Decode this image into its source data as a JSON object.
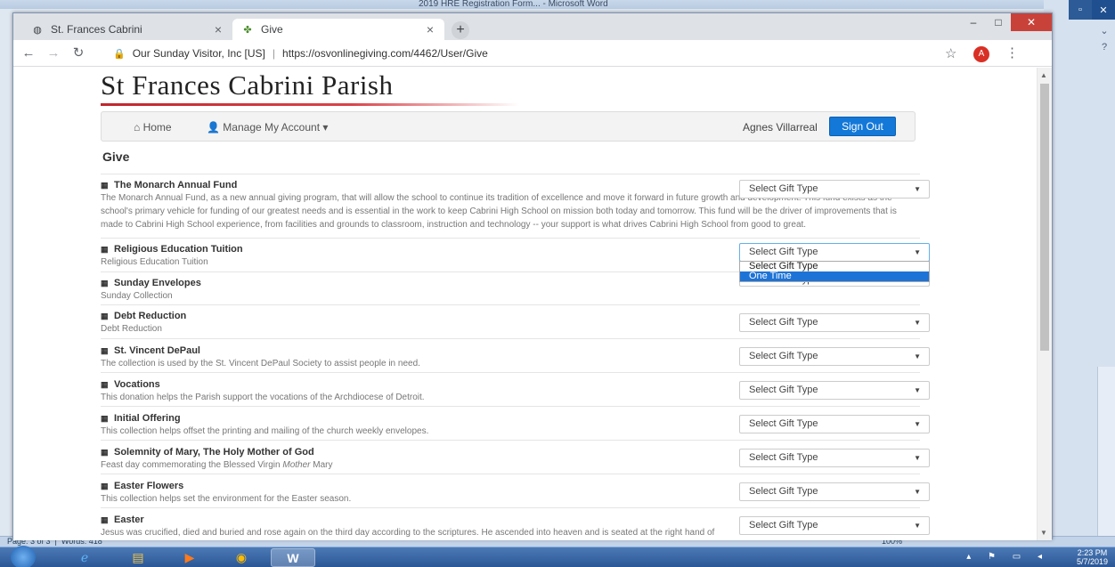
{
  "word": {
    "title": "2019 HRE Registration Form... - Microsoft Word",
    "status_page": "Page: 3 of 3",
    "status_words": "Words: 418",
    "zoom": "100%"
  },
  "browser": {
    "tabs": [
      {
        "label": "St. Frances Cabrini"
      },
      {
        "label": "Give"
      }
    ],
    "org": "Our Sunday Visitor, Inc [US]",
    "url": "https://osvonlinegiving.com/4462/User/Give",
    "profile_initial": "A"
  },
  "site": {
    "title": "St Frances Cabrini Parish",
    "nav_home": "Home",
    "nav_manage": "Manage My Account",
    "user_name": "Agnes Villarreal",
    "sign_out": "Sign Out",
    "page_heading": "Give"
  },
  "select_placeholder": "Select Gift Type",
  "dropdown_options": [
    "Select Gift Type",
    "One Time"
  ],
  "funds": [
    {
      "name": "The Monarch Annual Fund",
      "desc": "The Monarch Annual Fund, as a new annual giving program, that will allow the school to continue its tradition of excellence and move it forward in future growth and development.  This fund exists as the school's primary vehicle for funding of our greatest needs and is essential in the work to keep Cabrini High School on mission both today and tomorrow.  This fund will be the driver of improvements that is made to Cabrini High School experience, from facilities and grounds to classroom, instruction and technology -- your support is what drives Cabrini High School from good to great."
    },
    {
      "name": "Religious Education Tuition",
      "desc": "Religious Education Tuition"
    },
    {
      "name": "Sunday Envelopes",
      "desc": "Sunday Collection"
    },
    {
      "name": "Debt Reduction",
      "desc": "Debt Reduction"
    },
    {
      "name": "St. Vincent DePaul",
      "desc": "The collection is used by the St. Vincent DePaul Society to assist people in need."
    },
    {
      "name": "Vocations",
      "desc": "This donation helps the Parish support the vocations of the Archdiocese of Detroit."
    },
    {
      "name": "Initial Offering",
      "desc": "This collection helps offset the printing and mailing of the church weekly envelopes."
    },
    {
      "name": "Solemnity of Mary, The Holy Mother of God",
      "desc_pre": "Feast day commemorating the Blessed Virgin ",
      "desc_em": "Mother",
      "desc_post": " Mary"
    },
    {
      "name": "Easter Flowers",
      "desc": "This collection helps set the environment for the Easter season."
    },
    {
      "name": "Easter",
      "desc": "Jesus was crucified, died and buried and rose again on the third day according to the scriptures. He ascended into heaven and is seated at the right hand of the father.  He will come again in glory to judge the living and the dead and his kingdom will have no end. Amen."
    }
  ],
  "taskbar": {
    "time": "2:23 PM",
    "date": "5/7/2019"
  }
}
